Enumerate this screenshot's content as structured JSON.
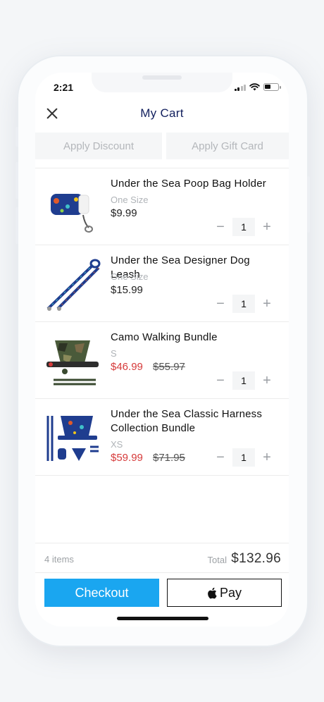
{
  "status_bar": {
    "time": "2:21"
  },
  "header": {
    "title": "My Cart",
    "close_icon": "close-icon"
  },
  "discounts": {
    "apply_discount": "Apply Discount",
    "apply_gift_card": "Apply Gift Card"
  },
  "items": [
    {
      "name": "Under the Sea Poop Bag Holder",
      "variant": "One Size",
      "price": "$9.99",
      "was": "",
      "qty": "1"
    },
    {
      "name": "Under the Sea Designer Dog Leash",
      "variant": "One Size",
      "price": "$15.99",
      "was": "",
      "qty": "1"
    },
    {
      "name": "Camo Walking Bundle",
      "variant": "S",
      "price": "$46.99",
      "was": "$55.97",
      "qty": "1"
    },
    {
      "name": "Under the Sea Classic Harness Collection Bundle",
      "variant": "XS",
      "price": "$59.99",
      "was": "$71.95",
      "qty": "1"
    }
  ],
  "qty_controls": {
    "minus": "−",
    "plus": "+"
  },
  "footer": {
    "count": "4 items",
    "total_label": "Total",
    "total_value": "$132.96",
    "checkout_label": "Checkout",
    "applepay_label": "Pay"
  },
  "colors": {
    "title": "#12205e",
    "checkout": "#1aa6f0",
    "sale": "#d63b3b"
  }
}
